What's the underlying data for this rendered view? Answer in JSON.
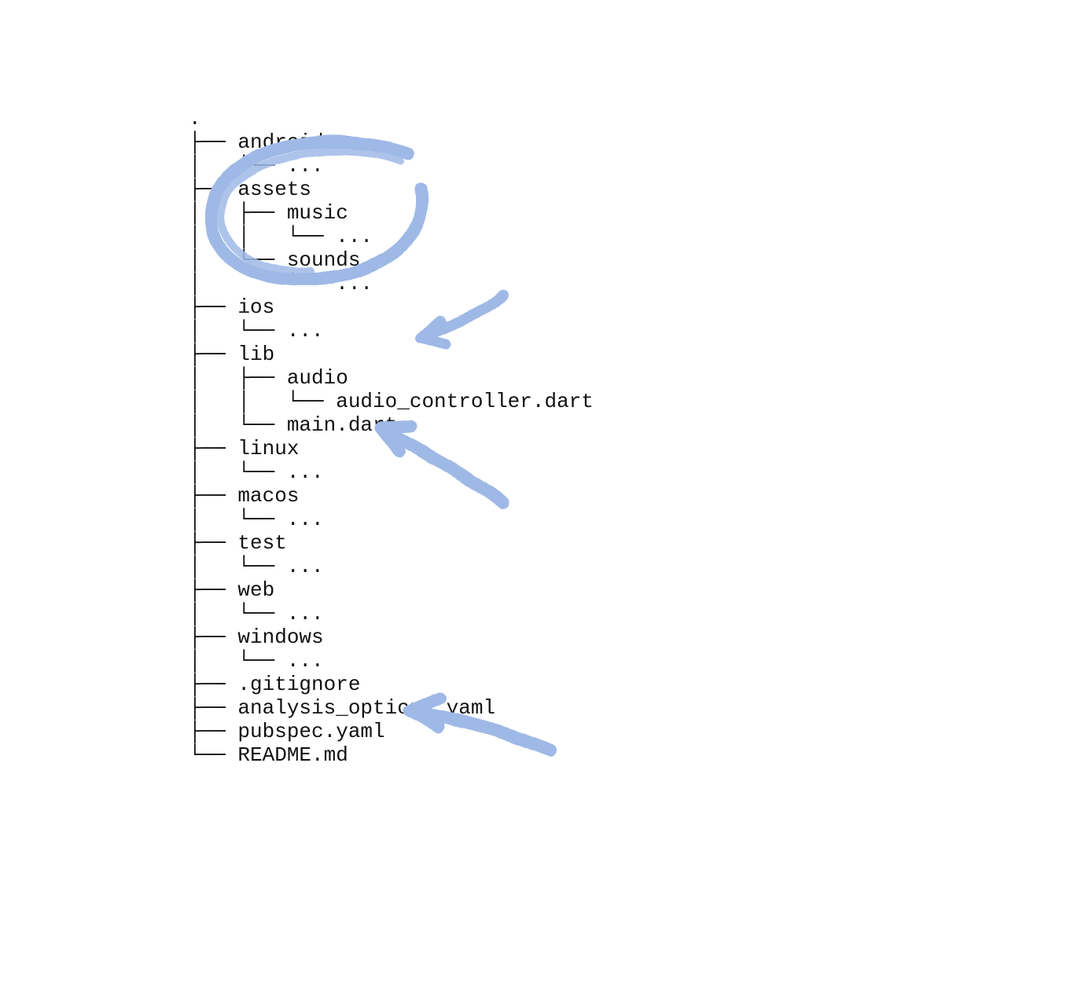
{
  "annotation_color": "#9fb9e6",
  "tree_lines": [
    ".",
    "├── android",
    "│   └── ...",
    "├── assets",
    "│   ├── music",
    "│   │   └── ...",
    "│   └── sounds",
    "│       └── ...",
    "├── ios",
    "│   └── ...",
    "├── lib",
    "│   ├── audio",
    "│   │   └── audio_controller.dart",
    "│   └── main.dart",
    "├── linux",
    "│   └── ...",
    "├── macos",
    "│   └── ...",
    "├── test",
    "│   └── ...",
    "├── web",
    "│   └── ...",
    "├── windows",
    "│   └── ...",
    "├── .gitignore",
    "├── analysis_options.yaml",
    "├── pubspec.yaml",
    "└── README.md"
  ],
  "tree_structure": {
    "name": ".",
    "children": [
      {
        "name": "android",
        "children": [
          {
            "name": "..."
          }
        ]
      },
      {
        "name": "assets",
        "children": [
          {
            "name": "music",
            "children": [
              {
                "name": "..."
              }
            ]
          },
          {
            "name": "sounds",
            "children": [
              {
                "name": "..."
              }
            ]
          }
        ]
      },
      {
        "name": "ios",
        "children": [
          {
            "name": "..."
          }
        ]
      },
      {
        "name": "lib",
        "children": [
          {
            "name": "audio",
            "children": [
              {
                "name": "audio_controller.dart"
              }
            ]
          },
          {
            "name": "main.dart"
          }
        ]
      },
      {
        "name": "linux",
        "children": [
          {
            "name": "..."
          }
        ]
      },
      {
        "name": "macos",
        "children": [
          {
            "name": "..."
          }
        ]
      },
      {
        "name": "test",
        "children": [
          {
            "name": "..."
          }
        ]
      },
      {
        "name": "web",
        "children": [
          {
            "name": "..."
          }
        ]
      },
      {
        "name": "windows",
        "children": [
          {
            "name": "..."
          }
        ]
      },
      {
        "name": ".gitignore"
      },
      {
        "name": "analysis_options.yaml"
      },
      {
        "name": "pubspec.yaml"
      },
      {
        "name": "README.md"
      }
    ]
  },
  "annotations": [
    {
      "type": "circle",
      "target": "assets directory"
    },
    {
      "type": "arrow",
      "target": "lib/audio"
    },
    {
      "type": "arrow",
      "target": "main.dart / linux area"
    },
    {
      "type": "arrow",
      "target": "pubspec.yaml"
    }
  ]
}
